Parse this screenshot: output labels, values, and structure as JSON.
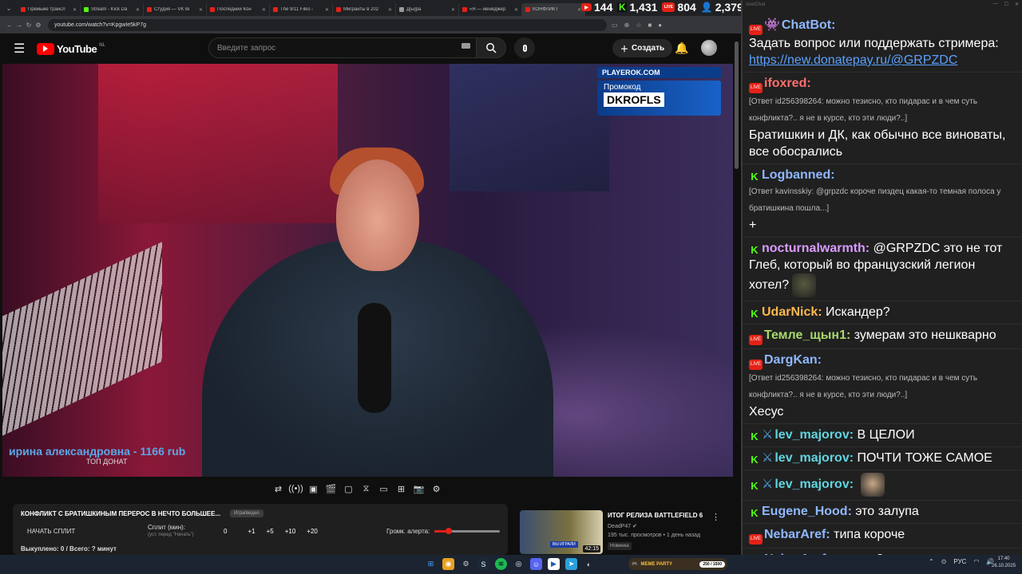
{
  "browser": {
    "tabs": [
      {
        "title": "Премьме трансл",
        "color": "#e62117"
      },
      {
        "title": "Stream - Kick Da",
        "color": "#53fc18"
      },
      {
        "title": "Студия — VK Bi",
        "color": "#e62117"
      },
      {
        "title": "Последний Кон",
        "color": "#e62117"
      },
      {
        "title": "The 9/11 Files -",
        "color": "#e62117"
      },
      {
        "title": "Мигранты в 202",
        "color": "#e62117"
      },
      {
        "title": "Д[ы]ра",
        "color": "#999999"
      },
      {
        "title": "«Я — менеджер",
        "color": "#e62117"
      },
      {
        "title": "КОНФЛИКТ",
        "color": "#e62117"
      }
    ],
    "url": "youtube.com/watch?v=KpgwIe5kP7g"
  },
  "stats": {
    "youtube": "144",
    "kick": "1,431",
    "vk": "804",
    "total": "2,379"
  },
  "youtube": {
    "logo": "YouTube",
    "country": "NL",
    "search_placeholder": "Введите запрос",
    "create_label": "Создать"
  },
  "video": {
    "sponsor_site": "PLAYEROK.COM",
    "sponsor_label": "Промокод",
    "sponsor_code": "DKROFLS",
    "top_donor": "ирина александровна - 1166 rub",
    "top_donor_label": "ТОП ДОНАТ"
  },
  "panel": {
    "title": "КОНФЛИКТ С БРАТИШКИНЫМ ПЕРЕРОС В НЕЧТО БОЛЬШЕЕ...",
    "tag": "Игра/видео",
    "split_button": "НАЧАТЬ СПЛИТ",
    "split_label": "Сплит (мин):",
    "split_sub": "(уст. перед \"Начать\")",
    "split_values": [
      "0",
      "+1",
      "+5",
      "+10",
      "+20"
    ],
    "volume_label": "Громк. алерта:",
    "volume_level": 0.22,
    "paid": "Выкуплено: 0 / Всего: ? минут"
  },
  "recommended": {
    "title": "ИТОГ РЕЛИЗА BATTLEFIELD 6",
    "channel": "DeadP47",
    "meta": "195 тыс. просмотров • 1 день назад",
    "badge": "Новинка",
    "duration": "42:15",
    "thumb_tag": "ВЫ ИГРАЛИ"
  },
  "chat": {
    "window_title": "AxelChat",
    "messages": [
      {
        "platform": "youtube",
        "user": "ChatBot:",
        "user_color": "#8fb8ff",
        "bot": true,
        "text": "Задать вопрос или поддержать стримера:",
        "link": "https://new.donatepay.ru/@GRPZDC"
      },
      {
        "platform": "youtube",
        "user": "ifoxred:",
        "user_color": "#ff6f6f",
        "reply": "[Ответ id256398264: можно тезисно, кто пидарас и в чем суть конфликта?.. я не в курсе, кто эти люди?..]",
        "text": "Братишкин и ДК, как обычно все виноваты, все обосрались"
      },
      {
        "platform": "kick",
        "user": "Logbanned:",
        "user_color": "#8fb8ff",
        "reply": "[Ответ kavinsskiy: @grpzdc короче пиздец какая-то темная полоса у братишкина пошла...]",
        "text": "+"
      },
      {
        "platform": "kick",
        "user": "nocturnalwarmth:",
        "user_color": "#d99cff",
        "text": "@GRPZDC это не тот Глеб, который во французский легион хотел?",
        "emote": "#5a5a40"
      },
      {
        "platform": "kick",
        "user": "UdarNick:",
        "user_color": "#ffb84d",
        "text": "Искандер?"
      },
      {
        "platform": "youtube",
        "user": "Темле_щын1:",
        "user_color": "#a8d86a",
        "text": "зумерам это нешкварно"
      },
      {
        "platform": "youtube",
        "user": "DargKan:",
        "user_color": "#8fb8ff",
        "reply": "[Ответ id256398264: можно тезисно, кто пидарас и в чем суть конфликта?.. я не в курсе, кто эти люди?..]",
        "text": "Хесус"
      },
      {
        "platform": "kick",
        "user": "lev_majorov:",
        "user_color": "#5fd6e0",
        "sword": true,
        "text": "В ЦЕЛОИ"
      },
      {
        "platform": "kick",
        "user": "lev_majorov:",
        "user_color": "#5fd6e0",
        "sword": true,
        "text": "ПОЧТИ ТОЖЕ САМОЕ"
      },
      {
        "platform": "kick",
        "user": "lev_majorov:",
        "user_color": "#5fd6e0",
        "sword": true,
        "text": "",
        "emote": "#c8a888"
      },
      {
        "platform": "kick",
        "user": "Eugene_Hood:",
        "user_color": "#8fb8ff",
        "text": "это залупа"
      },
      {
        "platform": "youtube",
        "user": "NebarAref:",
        "user_color": "#8fb8ff",
        "text": "типа короче"
      },
      {
        "platform": "youtube",
        "user": "NebarAref:",
        "user_color": "#8fb8ff",
        "text": "поняли?"
      }
    ]
  },
  "taskbar": {
    "game_name": "MEME PARTY",
    "game_progress": "250 / 1500",
    "lang": "РУС",
    "time": "17:40",
    "date": "26.10.2025"
  }
}
